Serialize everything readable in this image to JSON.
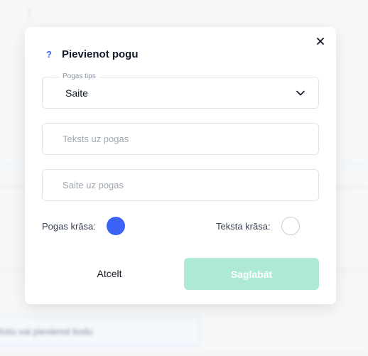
{
  "background": {
    "input_text": "kstu vai pievienot kodu"
  },
  "dialog": {
    "title": "Pievienot pogu",
    "help_icon": "?",
    "close_icon": "close-icon",
    "type_field": {
      "legend": "Pogas tips",
      "value": "Saite"
    },
    "text_field": {
      "placeholder": "Teksts uz pogas",
      "value": ""
    },
    "link_field": {
      "placeholder": "Saite uz pogas",
      "value": ""
    },
    "button_color": {
      "label": "Pogas krāsa:",
      "color": "#3b63f5"
    },
    "text_color": {
      "label": "Teksta krāsa:",
      "color": "#ffffff"
    },
    "cancel_label": "Atcelt",
    "save_label": "Saglabāt",
    "save_color": "#ade9d6"
  }
}
